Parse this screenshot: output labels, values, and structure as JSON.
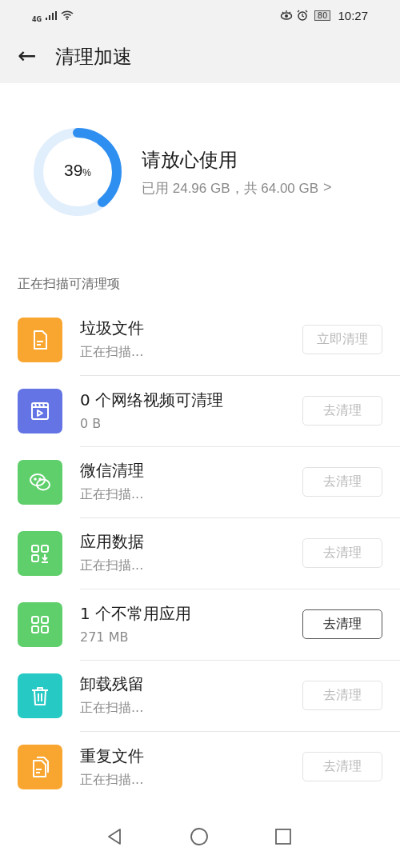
{
  "status_bar": {
    "network": "4G",
    "battery": "80",
    "time": "10:27"
  },
  "header": {
    "back": "←",
    "title": "清理加速"
  },
  "storage": {
    "level": 0.39,
    "percent": "39",
    "percent_sign": "%",
    "title": "请放心使用",
    "detail": "已用 24.96 GB，共 64.00 GB",
    "chevron": ">"
  },
  "section_label": "正在扫描可清理项",
  "items": [
    {
      "kind": "file",
      "color": "#f9a631",
      "title": "垃圾文件",
      "subtitle": "正在扫描...",
      "button": "立即清理",
      "disabled": true
    },
    {
      "kind": "video",
      "color": "#6474e5",
      "title": "0 个网络视频可清理",
      "subtitle": "0 B",
      "button": "去清理",
      "disabled": true
    },
    {
      "kind": "chat",
      "color": "#5ecf6a",
      "title": "微信清理",
      "subtitle": "正在扫描...",
      "button": "去清理",
      "disabled": true
    },
    {
      "kind": "appdata",
      "color": "#5ecf6a",
      "title": "应用数据",
      "subtitle": "正在扫描...",
      "button": "去清理",
      "disabled": true
    },
    {
      "kind": "apps",
      "color": "#5ecf6a",
      "title": "1 个不常用应用",
      "subtitle": "271 MB",
      "button": "去清理",
      "disabled": false
    },
    {
      "kind": "trash",
      "color": "#26c9c4",
      "title": "卸载残留",
      "subtitle": "正在扫描...",
      "button": "去清理",
      "disabled": true
    },
    {
      "kind": "files",
      "color": "#f9a631",
      "title": "重复文件",
      "subtitle": "正在扫描...",
      "button": "去清理",
      "disabled": true
    }
  ]
}
